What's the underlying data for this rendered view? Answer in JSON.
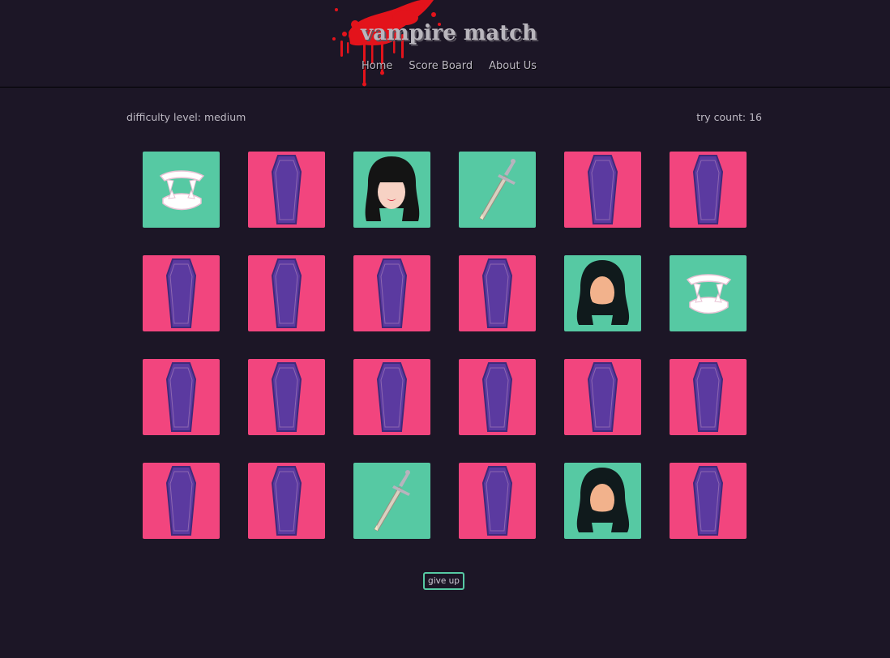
{
  "app": {
    "title": "vampire match"
  },
  "nav": {
    "items": [
      {
        "label": "Home"
      },
      {
        "label": "Score Board"
      },
      {
        "label": "About Us"
      }
    ]
  },
  "status": {
    "difficulty_label": "difficulty level: medium",
    "try_count_label": "try count: 16"
  },
  "board": {
    "columns": 6,
    "rows": 4,
    "cards": [
      {
        "state": "face",
        "icon": "fangs-icon"
      },
      {
        "state": "back",
        "icon": "coffin-icon"
      },
      {
        "state": "face",
        "icon": "woman-vampire-icon"
      },
      {
        "state": "face",
        "icon": "stake-icon"
      },
      {
        "state": "back",
        "icon": "coffin-icon"
      },
      {
        "state": "back",
        "icon": "coffin-icon"
      },
      {
        "state": "back",
        "icon": "coffin-icon"
      },
      {
        "state": "back",
        "icon": "coffin-icon"
      },
      {
        "state": "back",
        "icon": "coffin-icon"
      },
      {
        "state": "back",
        "icon": "coffin-icon"
      },
      {
        "state": "face",
        "icon": "bearded-vampire-icon"
      },
      {
        "state": "face",
        "icon": "fangs-icon"
      },
      {
        "state": "back",
        "icon": "coffin-icon"
      },
      {
        "state": "back",
        "icon": "coffin-icon"
      },
      {
        "state": "back",
        "icon": "coffin-icon"
      },
      {
        "state": "back",
        "icon": "coffin-icon"
      },
      {
        "state": "back",
        "icon": "coffin-icon"
      },
      {
        "state": "back",
        "icon": "coffin-icon"
      },
      {
        "state": "back",
        "icon": "coffin-icon"
      },
      {
        "state": "back",
        "icon": "coffin-icon"
      },
      {
        "state": "face",
        "icon": "stake-icon"
      },
      {
        "state": "back",
        "icon": "coffin-icon"
      },
      {
        "state": "face",
        "icon": "bearded-vampire-icon"
      },
      {
        "state": "back",
        "icon": "coffin-icon"
      }
    ]
  },
  "actions": {
    "give_up_label": "give up"
  },
  "colors": {
    "background": "#1c1626",
    "card_back": "#f2457e",
    "card_face": "#56c9a3",
    "coffin": "#5b3aa0",
    "blood": "#e3131b",
    "accent": "#56c9a3"
  }
}
